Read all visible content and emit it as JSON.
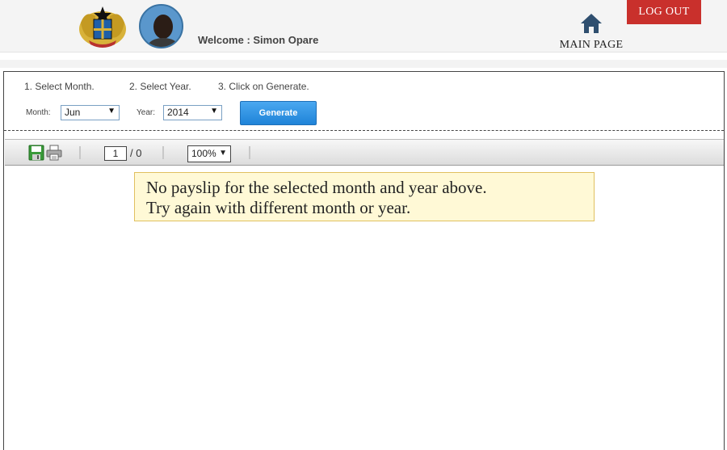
{
  "header": {
    "welcome_text": "Welcome : Simon Opare",
    "main_page_label": "MAIN PAGE",
    "logout_label": "LOG OUT"
  },
  "instructions": {
    "step1": "1. Select Month.",
    "step2": "2. Select Year.",
    "step3": "3. Click on Generate."
  },
  "filters": {
    "month_label": "Month:",
    "month_value": "Jun",
    "year_label": "Year:",
    "year_value": "2014",
    "generate_label": "Generate"
  },
  "viewer": {
    "current_page": "1",
    "total_pages": "/ 0",
    "zoom": "100%"
  },
  "message": {
    "line1": "No payslip for the selected month and year above.",
    "line2": "Try again with different month or year."
  },
  "colors": {
    "logout_bg": "#c9302c",
    "generate_bg": "#1f83d8",
    "notice_bg": "#fff9d6",
    "home_icon": "#2f4f6f"
  }
}
